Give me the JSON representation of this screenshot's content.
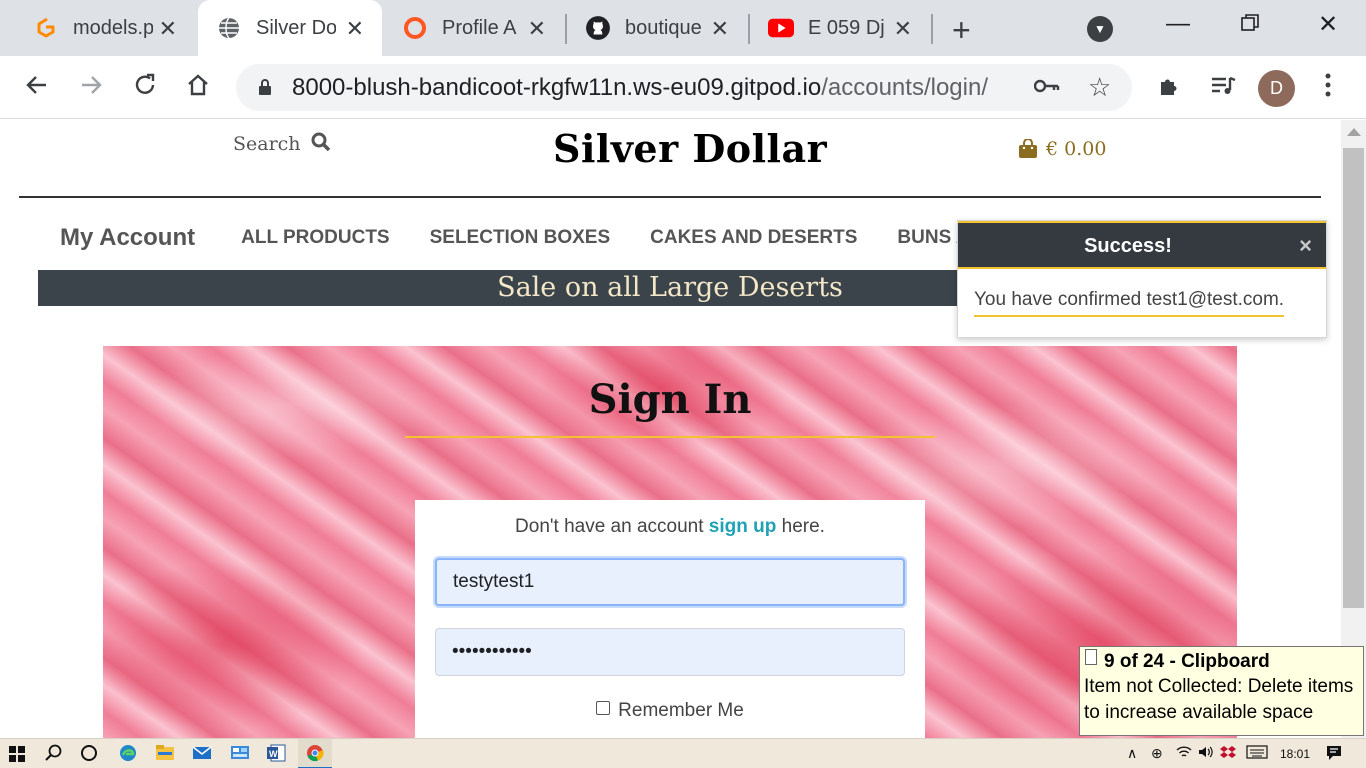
{
  "browser": {
    "tabs": [
      {
        "title": "models.p",
        "icon": "gitpod-logo-icon",
        "active": false
      },
      {
        "title": "Silver Do",
        "icon": "globe-icon",
        "active": true
      },
      {
        "title": "Profile A",
        "icon": "circle-orange-icon",
        "active": false
      },
      {
        "title": "boutique",
        "icon": "github-icon",
        "active": false
      },
      {
        "title": "E 059 Dj",
        "icon": "youtube-icon",
        "active": false
      }
    ],
    "url_host": "8000-blush-bandicoot-rkgfw11n.ws-eu09.gitpod.io",
    "url_path": "/accounts/login/",
    "profile_initial": "D"
  },
  "site": {
    "search_label": "Search",
    "brand": "Silver Dollar",
    "cart_total": "€ 0.00",
    "nav": {
      "my_account": "My Account",
      "items": [
        "ALL PRODUCTS",
        "SELECTION BOXES",
        "CAKES AND DESERTS",
        "BUNS A"
      ]
    },
    "banner": "Sale on all Large Deserts"
  },
  "signin": {
    "title": "Sign In",
    "prompt_before": "Don't have an account",
    "signup_link": "sign up",
    "prompt_after": "here.",
    "username_value": "testytest1",
    "password_value": "••••••••••••",
    "remember_label": "Remember Me"
  },
  "toast": {
    "title": "Success!",
    "close": "×",
    "message": "You have confirmed test1@test.com."
  },
  "clipboard": {
    "header": "9 of 24 - Clipboard",
    "line1": "Item not Collected: Delete items",
    "line2": "to increase available space"
  },
  "taskbar": {
    "time": "18:01"
  },
  "colors": {
    "accent_gold": "#f2c230",
    "dark_slate": "#3b434b",
    "link_teal": "#1fa1b6",
    "bag_gold": "#8a6d1f"
  }
}
